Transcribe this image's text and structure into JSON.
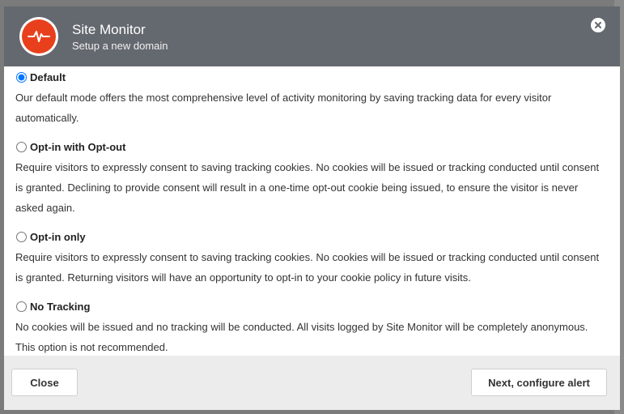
{
  "header": {
    "title": "Site Monitor",
    "subtitle": "Setup a new domain",
    "logo_icon": "heartbeat-icon",
    "close_icon": "close-icon"
  },
  "options": [
    {
      "label": "Default",
      "checked": true,
      "description": "Our default mode offers the most comprehensive level of activity monitoring by saving tracking data for every visitor automatically."
    },
    {
      "label": "Opt-in with Opt-out",
      "checked": false,
      "description": "Require visitors to expressly consent to saving tracking cookies. No cookies will be issued or tracking conducted until consent is granted. Declining to provide consent will result in a one-time opt-out cookie being issued, to ensure the visitor is never asked again."
    },
    {
      "label": "Opt-in only",
      "checked": false,
      "description": "Require visitors to expressly consent to saving tracking cookies. No cookies will be issued or tracking conducted until consent is granted. Returning visitors will have an opportunity to opt-in to your cookie policy in future visits."
    },
    {
      "label": "No Tracking",
      "checked": false,
      "description": "No cookies will be issued and no tracking will be conducted. All visits logged by Site Monitor will be completely anonymous. This option is not recommended."
    }
  ],
  "footer": {
    "close_label": "Close",
    "next_label": "Next, configure alert"
  },
  "colors": {
    "header_bg": "#64686f",
    "logo_red": "#e8401c",
    "footer_bg": "#ececec"
  }
}
